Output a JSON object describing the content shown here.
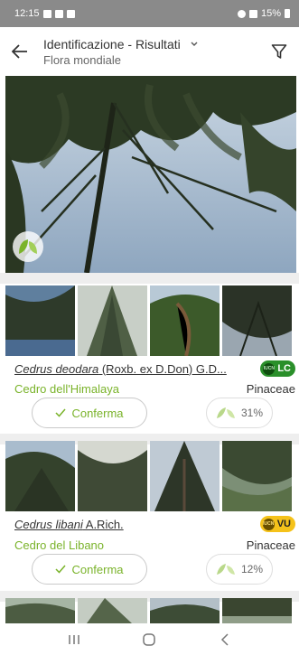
{
  "status_bar": {
    "time": "12:15",
    "battery": "15%"
  },
  "header": {
    "title": "Identificazione - Risultati",
    "subtitle": "Flora mondiale"
  },
  "colors": {
    "accent_green": "#7ab32a",
    "iucn_lc": "#2a8f2a",
    "iucn_vu": "#f5c21a"
  },
  "icons": {
    "back": "arrow-left-icon",
    "dropdown": "chevron-down-icon",
    "filter": "filter-funnel-icon",
    "organ": "leaf-icon",
    "confirm": "check-icon",
    "score": "leaves-icon"
  },
  "results": [
    {
      "scientific_name": "Cedrus deodara",
      "author": " (Roxb. ex D.Don) G.D...",
      "iucn_label": "IUCN",
      "iucn": "LC",
      "common_name": "Cedro dell'Himalaya",
      "family": "Pinaceae",
      "confirm_label": "Conferma",
      "score": "31%"
    },
    {
      "scientific_name": "Cedrus libani",
      "author": " A.Rich.",
      "iucn_label": "IUCN",
      "iucn": "VU",
      "common_name": "Cedro del Libano",
      "family": "Pinaceae",
      "confirm_label": "Conferma",
      "score": "12%"
    }
  ]
}
